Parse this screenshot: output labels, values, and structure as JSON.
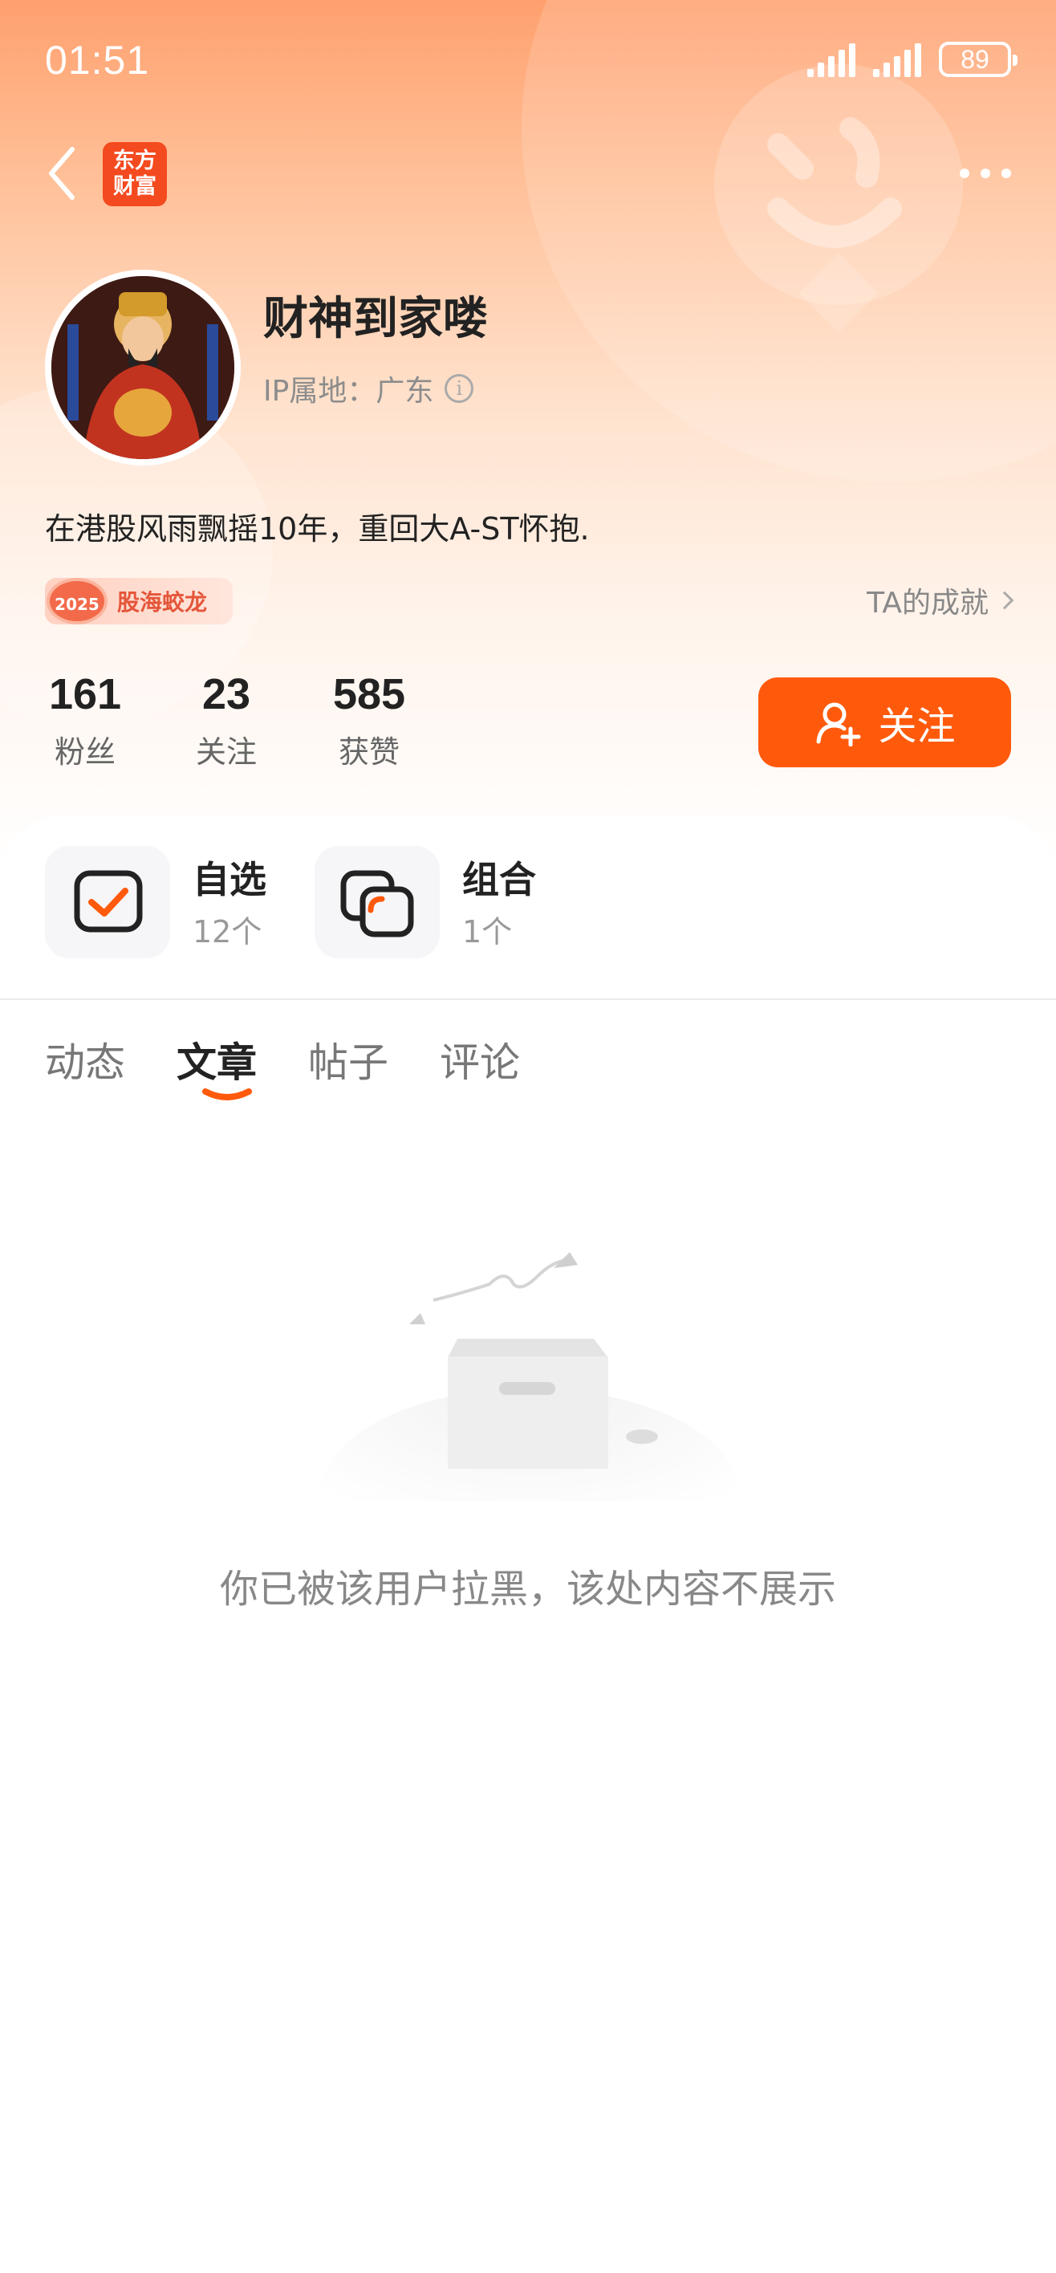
{
  "status_bar": {
    "time": "01:51",
    "battery": "89"
  },
  "nav": {
    "logo_text": "东方\n财富"
  },
  "profile": {
    "name": "财神到家喽",
    "ip_label": "IP属地：广东",
    "bio": "在港股风雨飘摇10年，重回大A-ST怀抱.",
    "badge_year": "2025",
    "badge_label": "股海蛟龙",
    "achievements_link": "TA的成就"
  },
  "stats": [
    {
      "value": "161",
      "label": "粉丝"
    },
    {
      "value": "23",
      "label": "关注"
    },
    {
      "value": "585",
      "label": "获赞"
    }
  ],
  "follow_button": "关注",
  "quick_links": [
    {
      "title": "自选",
      "count": "12个",
      "icon": "checklist-icon"
    },
    {
      "title": "组合",
      "count": "1个",
      "icon": "portfolio-icon"
    }
  ],
  "tabs": [
    {
      "label": "动态",
      "active": false
    },
    {
      "label": "文章",
      "active": true
    },
    {
      "label": "帖子",
      "active": false
    },
    {
      "label": "评论",
      "active": false
    }
  ],
  "empty_state": {
    "message": "你已被该用户拉黑，该处内容不展示"
  },
  "colors": {
    "accent": "#ff5a0c",
    "header_top": "#ffa06e"
  }
}
